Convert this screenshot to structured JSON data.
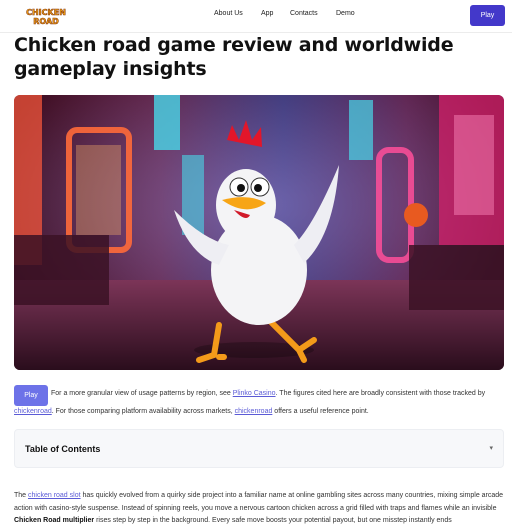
{
  "header": {
    "logo_line1": "CHICKEN",
    "logo_line2": "ROAD",
    "nav": [
      "About Us",
      "App",
      "Contacts",
      "Demo"
    ],
    "play_label": "Play"
  },
  "page_title": "Chicken road game review and worldwide gameplay insights",
  "intro": {
    "play_label": "Play",
    "line1_a": "For a more granular view of usage patterns by region, see ",
    "line1_link": "Plinko Casino",
    "line1_b": ". The figures cited here are broadly consistent with those tracked by",
    "line2_link1": "chickenroad",
    "line2_a": ". For those comparing platform availability across markets, ",
    "line2_link2": "chickenroad",
    "line2_b": " offers a useful reference point."
  },
  "toc": {
    "title": "Table of Contents",
    "chevron": "▾"
  },
  "body": {
    "text_a": "The ",
    "link": "chicken road slot",
    "text_b": " has quickly evolved from a quirky side project into a familiar name at online gambling sites across many countries, mixing simple arcade action with casino-style suspense. Instead of spinning reels, you move a nervous cartoon chicken across a grid filled with traps and flames while an invisible ",
    "bold": "Chicken Road multiplier",
    "text_c": " rises step by step in the background. Every safe move boosts your potential payout, but one misstep instantly ends"
  },
  "colors": {
    "accent": "#4338ca",
    "link": "#5b5bd6"
  }
}
